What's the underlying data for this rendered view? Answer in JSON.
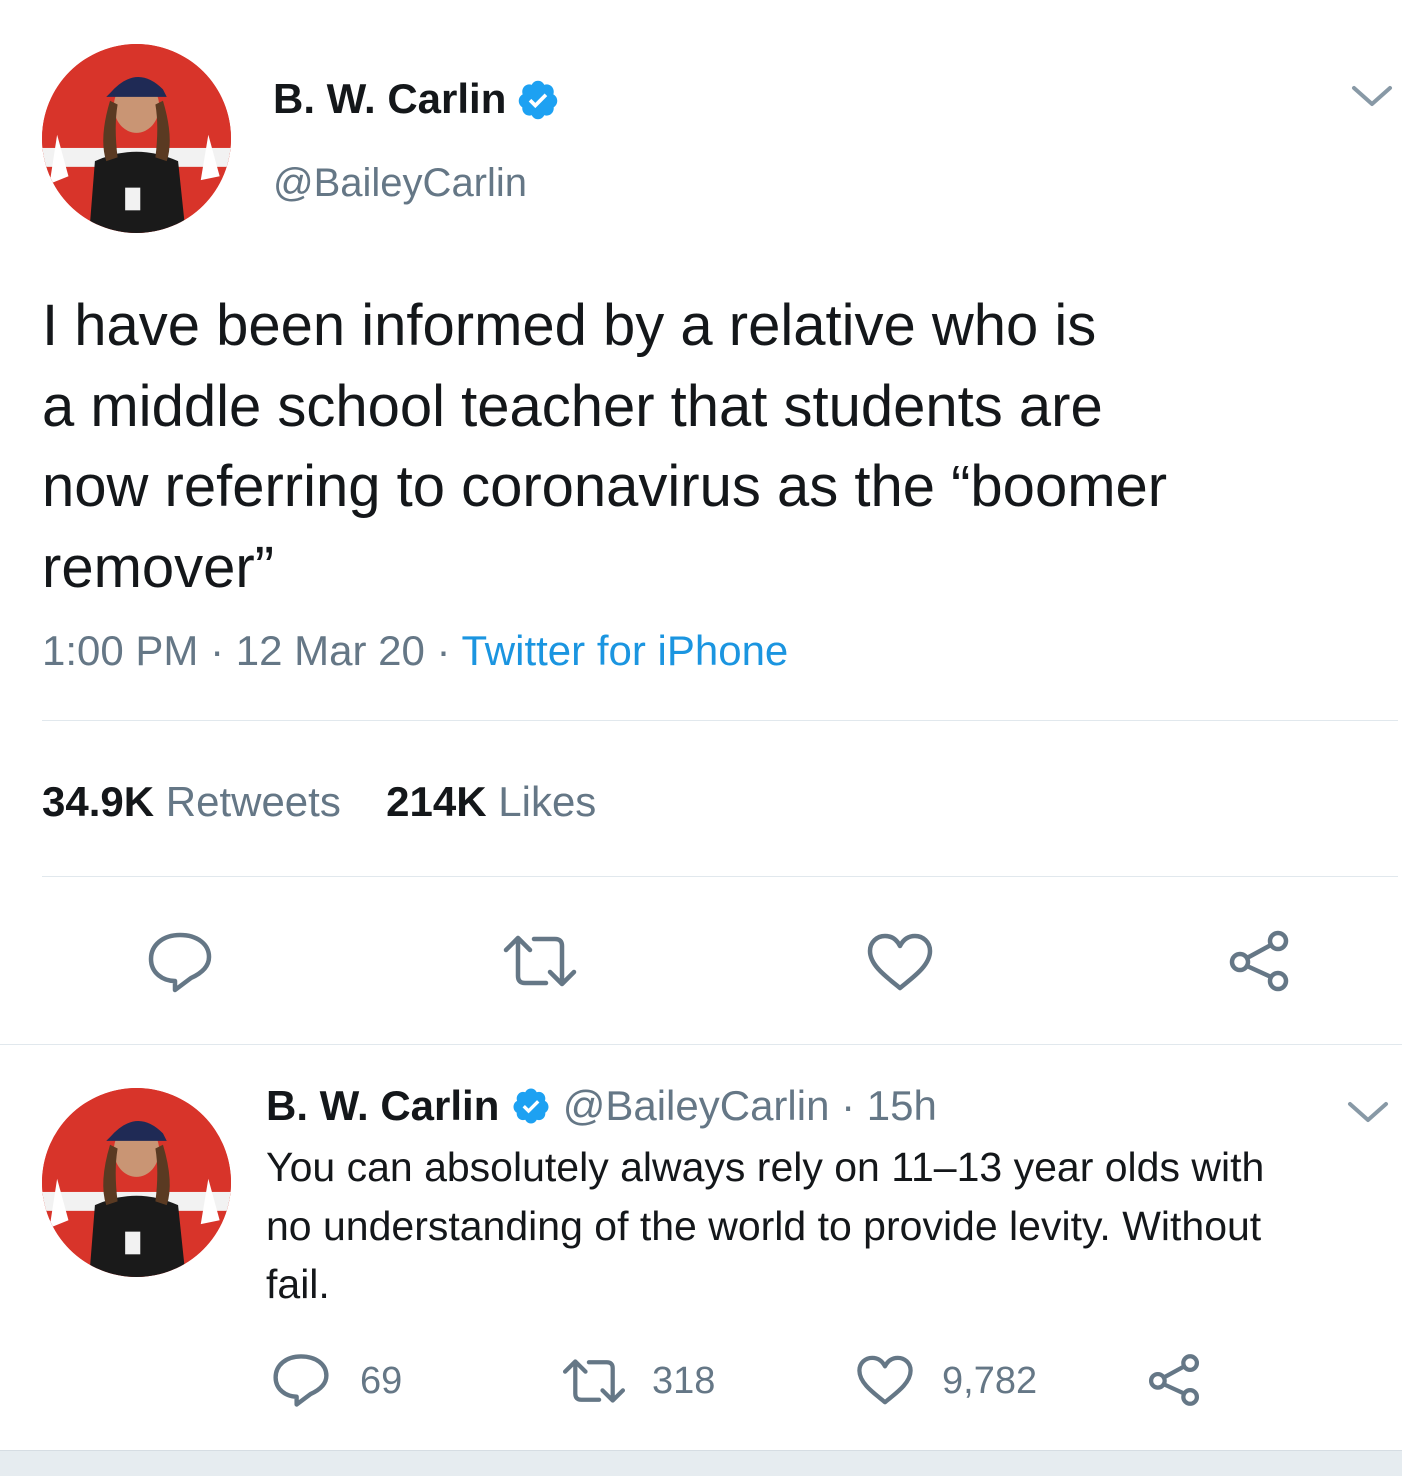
{
  "main_tweet": {
    "author_name": "B. W. Carlin",
    "handle": "@BaileyCarlin",
    "text_lines": [
      "I have been informed by a relative who is",
      "a middle school teacher that students are",
      "now referring to coronavirus as the “boomer",
      "remover”"
    ],
    "time": "1:00 PM",
    "sep1": "·",
    "date": "12 Mar 20",
    "sep2": "·",
    "source": "Twitter for iPhone",
    "retweets_count": "34.9K",
    "retweets_label": "Retweets",
    "likes_count": "214K",
    "likes_label": "Likes"
  },
  "reply_tweet": {
    "author_name": "B. W. Carlin",
    "handle": "@BaileyCarlin",
    "sep": "·",
    "age": "15h",
    "text_lines": [
      "You can absolutely always rely on 11–13 year olds with",
      "no understanding of the world to provide levity. Without",
      "fail."
    ],
    "reply_count": "69",
    "retweet_count": "318",
    "like_count": "9,782"
  },
  "colors": {
    "accent": "#1b95e0",
    "muted": "#657786",
    "text": "#14171a",
    "divider": "#e1e8ed"
  },
  "icons": [
    "chevron-down-icon",
    "verified-badge-icon",
    "reply-icon",
    "retweet-icon",
    "like-icon",
    "share-icon"
  ]
}
